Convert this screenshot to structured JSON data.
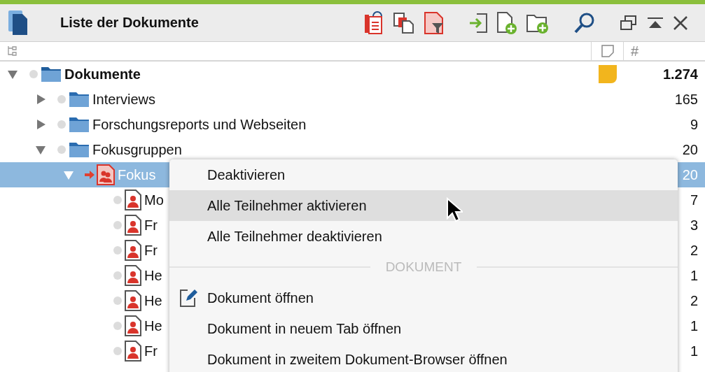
{
  "window": {
    "title": "Liste der Dokumente"
  },
  "columns": {
    "count_header": "#"
  },
  "tree": [
    {
      "label": "Dokumente",
      "kind": "root",
      "expanded": true,
      "selected": false,
      "open": false,
      "memo": true,
      "count": "1.274",
      "children": [
        {
          "label": "Interviews",
          "kind": "folder",
          "expanded": false,
          "selected": false,
          "open": false,
          "count": "165"
        },
        {
          "label": "Forschungsreports und Webseiten",
          "kind": "folder",
          "expanded": false,
          "selected": false,
          "open": false,
          "count": "9"
        },
        {
          "label": "Fokusgruppen",
          "kind": "folder",
          "expanded": true,
          "selected": false,
          "open": false,
          "count": "20",
          "children": [
            {
              "label": "Fokus",
              "kind": "focus-group",
              "expanded": true,
              "selected": true,
              "open": true,
              "count": "20",
              "children": [
                {
                  "label": "Mo",
                  "kind": "participant",
                  "selected": false,
                  "open": false,
                  "count": "7"
                },
                {
                  "label": "Fr",
                  "kind": "participant",
                  "selected": false,
                  "open": false,
                  "count": "3"
                },
                {
                  "label": "Fr",
                  "kind": "participant",
                  "selected": false,
                  "open": false,
                  "count": "2"
                },
                {
                  "label": "He",
                  "kind": "participant",
                  "selected": false,
                  "open": false,
                  "count": "1"
                },
                {
                  "label": "He",
                  "kind": "participant",
                  "selected": false,
                  "open": false,
                  "count": "2"
                },
                {
                  "label": "He",
                  "kind": "participant",
                  "selected": false,
                  "open": false,
                  "count": "1"
                },
                {
                  "label": "Fr",
                  "kind": "participant",
                  "selected": false,
                  "open": false,
                  "count": "1"
                }
              ]
            }
          ]
        }
      ]
    }
  ],
  "context_menu": [
    {
      "kind": "item",
      "label": "Deaktivieren",
      "selected": false,
      "icon": false
    },
    {
      "kind": "item",
      "label": "Alle Teilnehmer aktivieren",
      "selected": true,
      "icon": false
    },
    {
      "kind": "item",
      "label": "Alle Teilnehmer deaktivieren",
      "selected": false,
      "icon": false
    },
    {
      "kind": "section",
      "label": "DOKUMENT"
    },
    {
      "kind": "item",
      "label": "Dokument öffnen",
      "selected": false,
      "icon": true
    },
    {
      "kind": "item",
      "label": "Dokument in neuem Tab öffnen",
      "selected": false,
      "icon": false
    },
    {
      "kind": "item",
      "label": "Dokument in zweitem Dokument-Browser öffnen",
      "selected": false,
      "icon": false
    }
  ]
}
